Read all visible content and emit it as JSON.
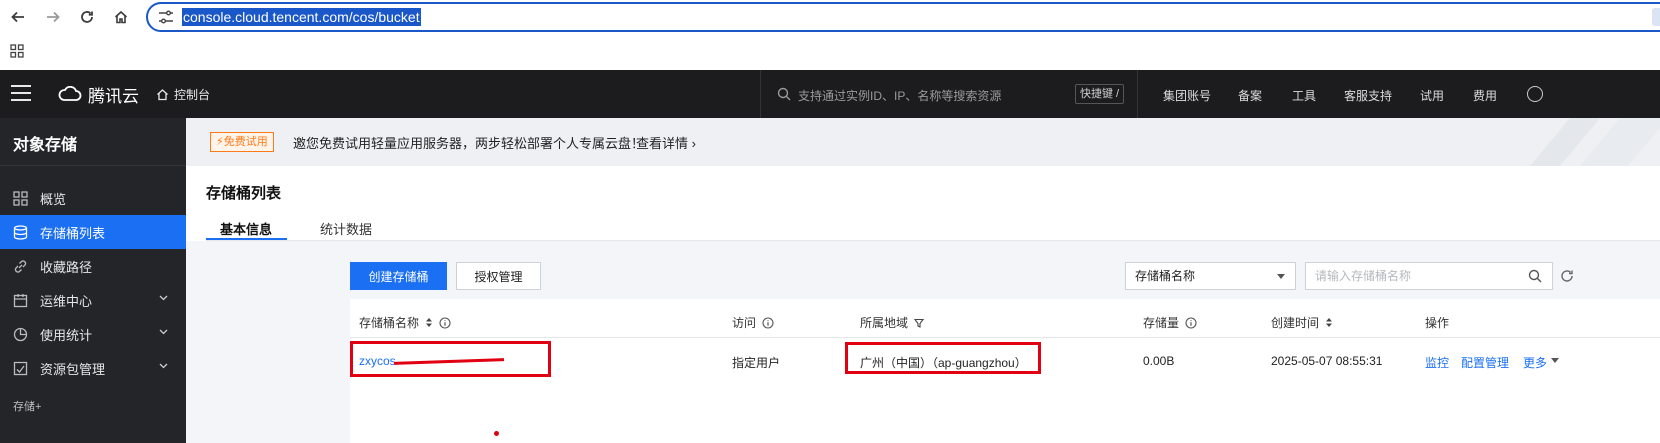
{
  "browser": {
    "url": "console.cloud.tencent.com/cos/bucket"
  },
  "topnav": {
    "brand": "腾讯云",
    "console": "控制台",
    "search_placeholder": "支持通过实例ID、IP、名称等搜索资源",
    "shortcut": "快捷键 /",
    "links": [
      "集团账号",
      "备案",
      "工具",
      "客服支持",
      "试用",
      "费用"
    ]
  },
  "sidebar": {
    "title": "对象存储",
    "items": [
      {
        "label": "概览",
        "icon": "overview-icon"
      },
      {
        "label": "存储桶列表",
        "icon": "bucket-icon"
      },
      {
        "label": "收藏路径",
        "icon": "link-icon"
      },
      {
        "label": "运维中心",
        "icon": "calendar-icon"
      },
      {
        "label": "使用统计",
        "icon": "pie-icon"
      },
      {
        "label": "资源包管理",
        "icon": "package-icon"
      }
    ],
    "section": "存储+"
  },
  "promo": {
    "badge": "⚡免费试用",
    "text": "邀您免费试用轻量应用服务器，两步轻松部署个人专属云盘！",
    "link": "查看详情 ›"
  },
  "page": {
    "title": "存储桶列表",
    "tabs": [
      "基本信息",
      "统计数据"
    ]
  },
  "toolbar": {
    "create": "创建存储桶",
    "auth": "授权管理",
    "filter_select": "存储桶名称",
    "search_placeholder": "请输入存储桶名称"
  },
  "table": {
    "headers": [
      "存储桶名称",
      "访问",
      "所属地域",
      "存储量",
      "创建时间",
      "操作"
    ],
    "rows": [
      {
        "name": "zxycos",
        "access": "指定用户",
        "region": "广州（中国）（ap-guangzhou）",
        "size": "0.00B",
        "created": "2025-05-07 08:55:31",
        "actions": [
          "监控",
          "配置管理",
          "更多"
        ]
      }
    ]
  },
  "colors": {
    "accent": "#1a6ff2",
    "topnav_bg": "#1c1c1f",
    "sidebar_bg": "#232529",
    "annotation_red": "#e00012"
  }
}
